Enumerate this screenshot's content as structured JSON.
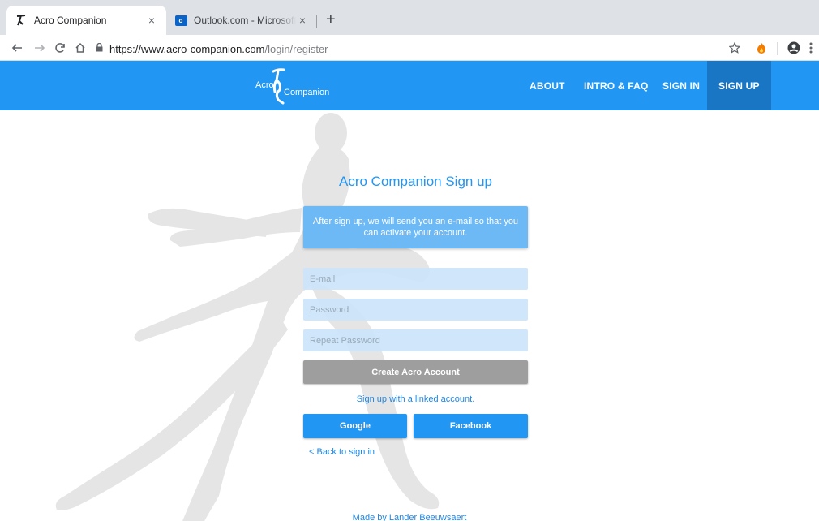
{
  "browser": {
    "tabs": [
      {
        "title": "Acro Companion",
        "active": true
      },
      {
        "title": "Outlook.com - Microsoft free p",
        "active": false
      }
    ],
    "close_glyph": "×",
    "new_tab_glyph": "+",
    "url_domain": "https://www.acro-companion.com",
    "url_path": "/login/register",
    "outlook_icon_text": "o"
  },
  "header": {
    "logo_word_1": "Acro",
    "logo_word_2": "Companion",
    "nav": [
      "ABOUT",
      "INTRO & FAQ",
      "SIGN IN",
      "SIGN UP"
    ],
    "active_nav": "SIGN UP"
  },
  "form": {
    "heading": "Acro Companion Sign up",
    "info": "After sign up, we will send you an e-mail so that you can activate your account.",
    "email_placeholder": "E-mail",
    "password_placeholder": "Password",
    "repeat_placeholder": "Repeat Password",
    "create_button": "Create Acro Account",
    "linked_text": "Sign up with a linked account.",
    "google_button": "Google",
    "facebook_button": "Facebook",
    "back_link": "< Back to sign in"
  },
  "footer": {
    "credit": "Made by Lander Beeuwsaert"
  },
  "colors": {
    "brand": "#2196f3",
    "brand_dark": "#1976c5",
    "disabled_button": "#9e9e9e"
  }
}
